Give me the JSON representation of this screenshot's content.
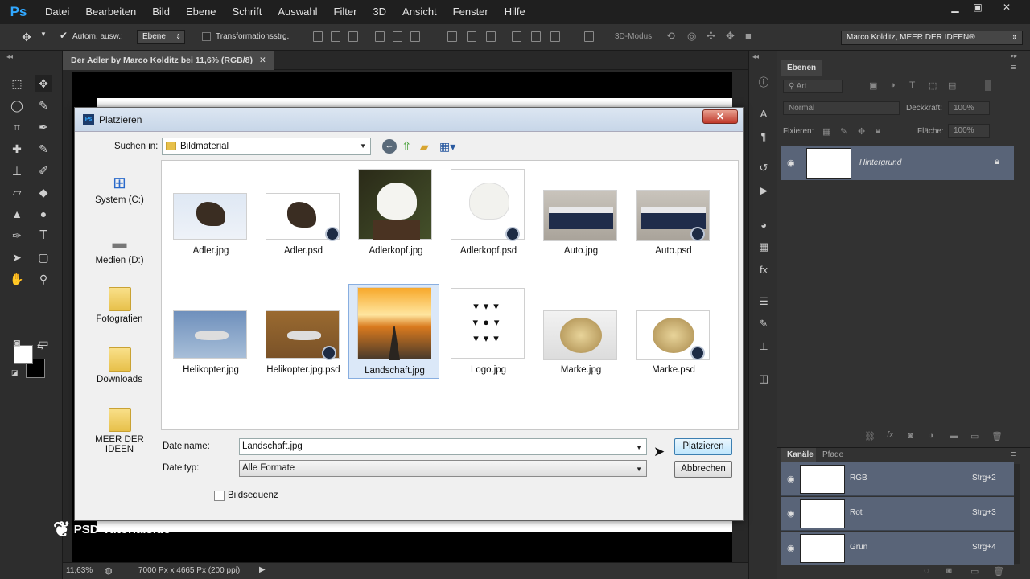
{
  "app": {
    "logo": "Ps",
    "menu": [
      "Datei",
      "Bearbeiten",
      "Bild",
      "Ebene",
      "Schrift",
      "Auswahl",
      "Filter",
      "3D",
      "Ansicht",
      "Fenster",
      "Hilfe"
    ]
  },
  "options": {
    "auto_select_label": "Autom. ausw.:",
    "auto_select_value": "Ebene",
    "transform_label": "Transformationsstrg.",
    "mode3d_label": "3D-Modus:",
    "workspace": "Marco Kolditz, MEER DER IDEEN®"
  },
  "document": {
    "tab_title": "Der Adler by Marco Kolditz bei 11,6% (RGB/8)",
    "zoom": "11,63%",
    "doc_info": "7000 Px x 4665 Px (200 ppi)",
    "watermark": "PSD-Tutorials.de"
  },
  "layers_panel": {
    "tab": "Ebenen",
    "filter_kind": "Art",
    "blend_mode": "Normal",
    "opacity_label": "Deckkraft:",
    "opacity_value": "100%",
    "lock_label": "Fixieren:",
    "fill_label": "Fläche:",
    "fill_value": "100%",
    "layer_name": "Hintergrund"
  },
  "channels_panel": {
    "tabs": [
      "Kanäle",
      "Pfade"
    ],
    "channels": [
      {
        "name": "RGB",
        "shortcut": "Strg+2"
      },
      {
        "name": "Rot",
        "shortcut": "Strg+3"
      },
      {
        "name": "Grün",
        "shortcut": "Strg+4"
      }
    ]
  },
  "dialog": {
    "title": "Platzieren",
    "look_in_label": "Suchen in:",
    "look_in_value": "Bildmaterial",
    "places": [
      "System (C:)",
      "Medien (D:)",
      "Fotografien",
      "Downloads",
      "MEER DER IDEEN"
    ],
    "files": [
      "Adler.jpg",
      "Adler.psd",
      "Adlerkopf.jpg",
      "Adlerkopf.psd",
      "Auto.jpg",
      "Auto.psd",
      "Helikopter.jpg",
      "Helikopter.jpg.psd",
      "Landschaft.jpg",
      "Logo.jpg",
      "Marke.jpg",
      "Marke.psd"
    ],
    "filename_label": "Dateiname:",
    "filename_value": "Landschaft.jpg",
    "filetype_label": "Dateityp:",
    "filetype_value": "Alle Formate",
    "sequence_label": "Bildsequenz",
    "place_button": "Platzieren",
    "cancel_button": "Abbrechen"
  }
}
